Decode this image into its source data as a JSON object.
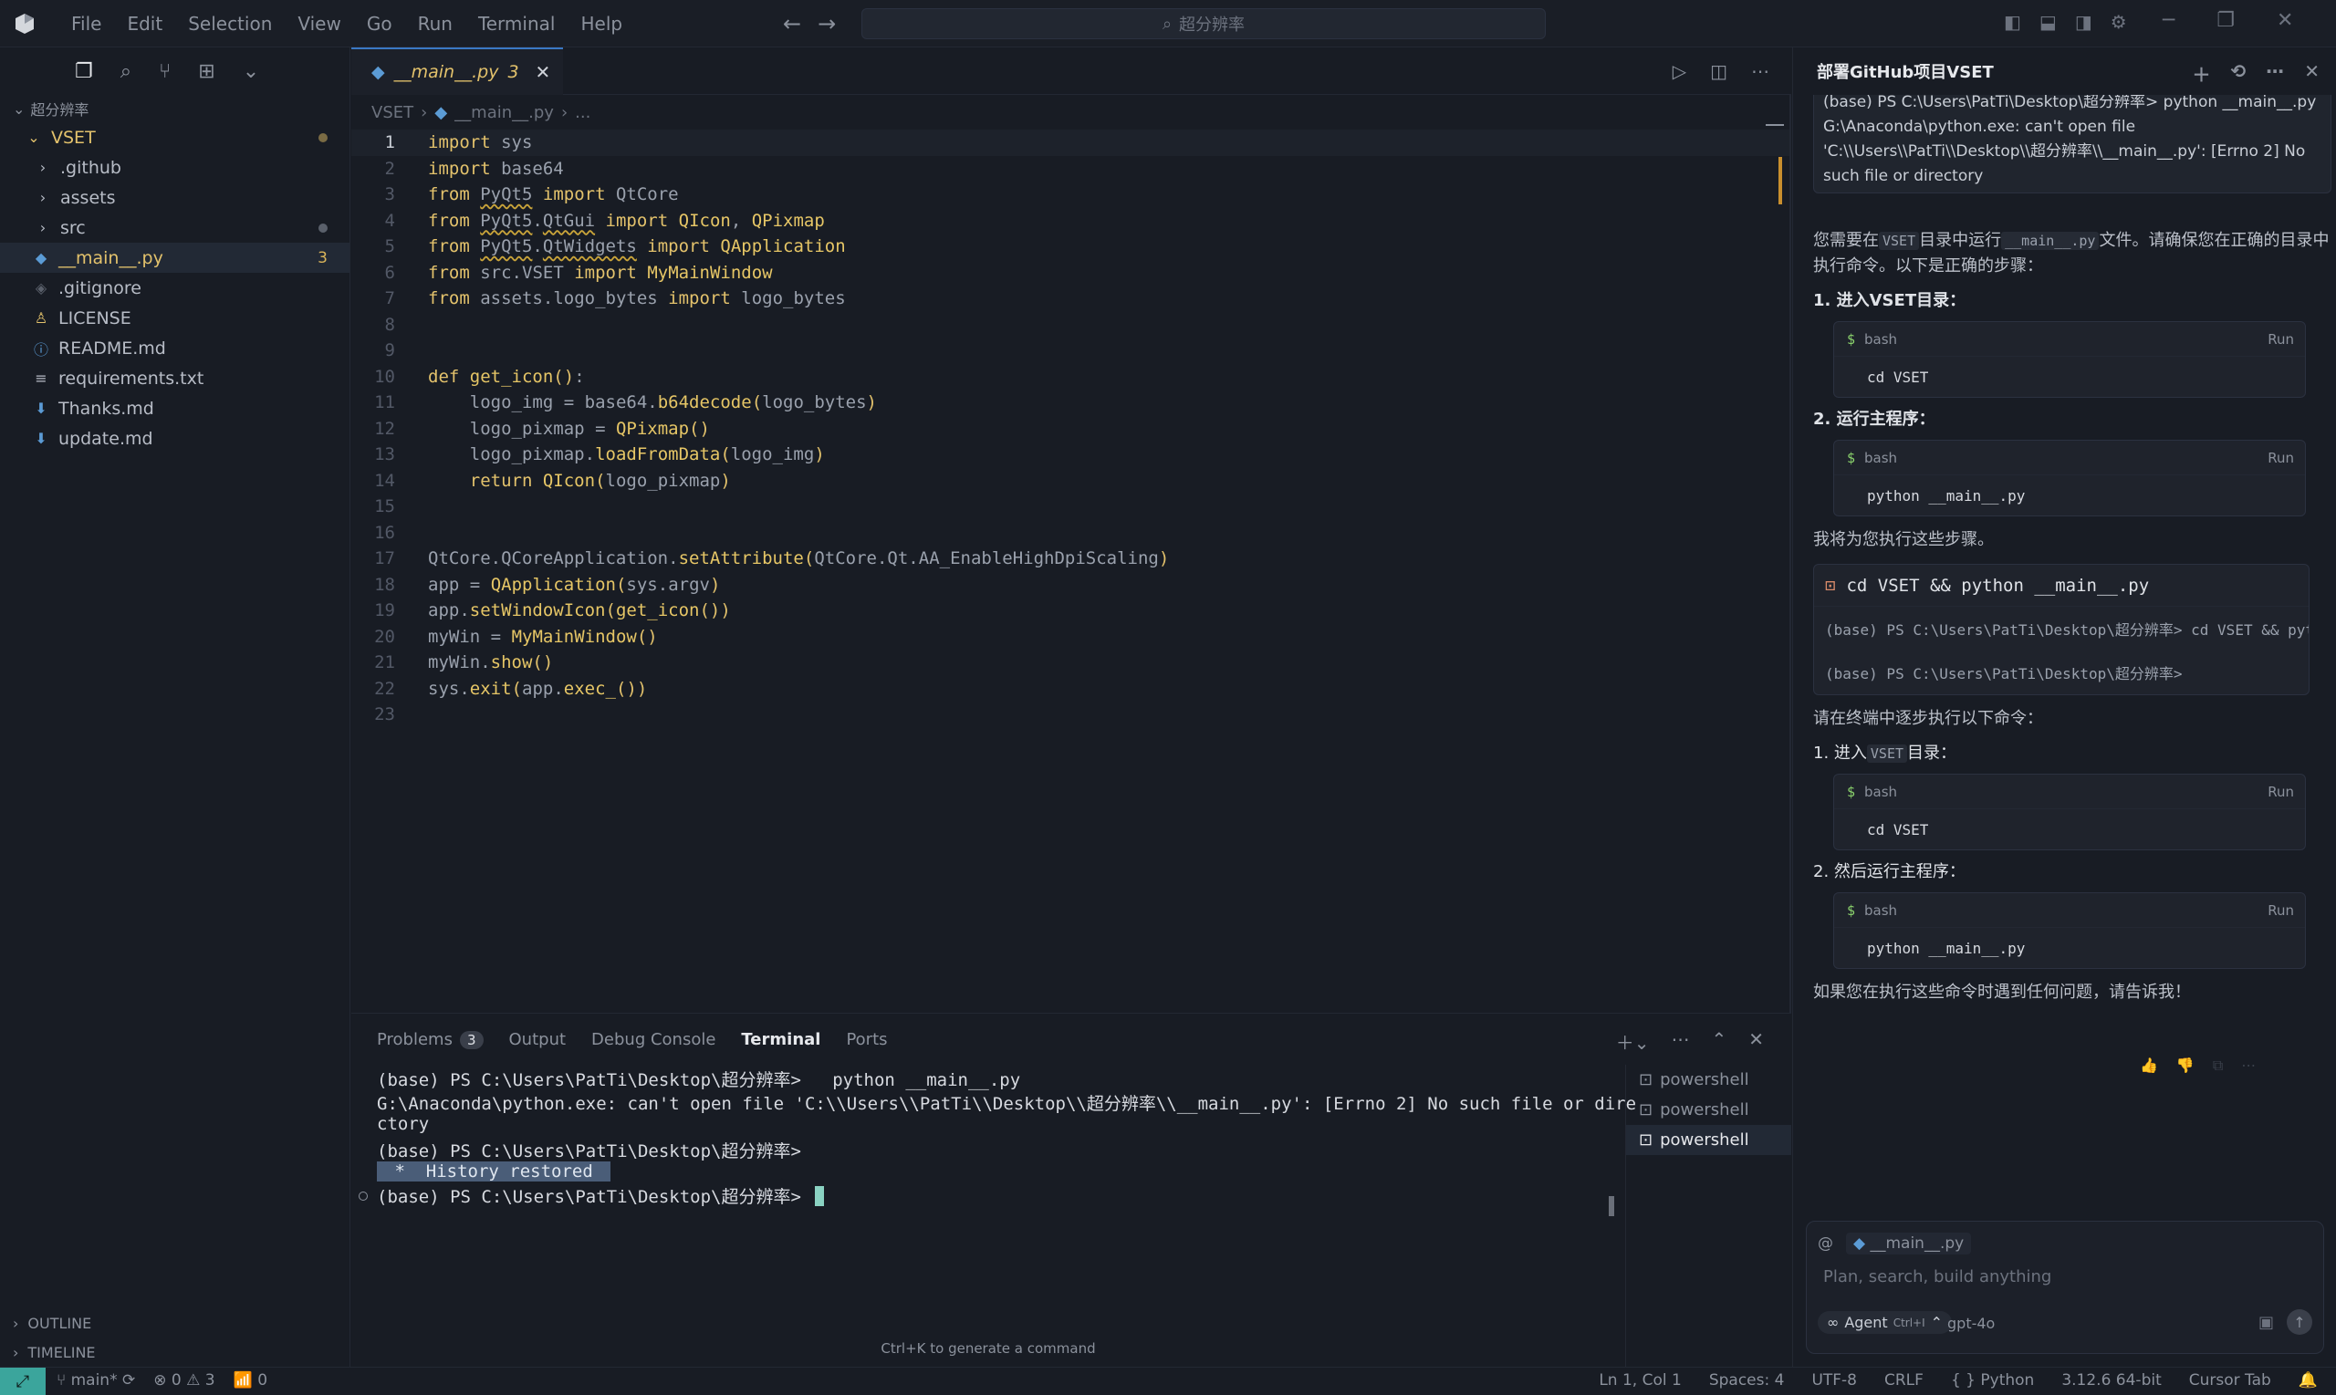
{
  "menu": [
    "File",
    "Edit",
    "Selection",
    "View",
    "Go",
    "Run",
    "Terminal",
    "Help"
  ],
  "search": {
    "placeholder": "超分辨率"
  },
  "explorer": {
    "workspace": "超分辨率",
    "root": "VSET",
    "items": [
      {
        "label": ".github",
        "type": "folder"
      },
      {
        "label": "assets",
        "type": "folder"
      },
      {
        "label": "src",
        "type": "folder"
      },
      {
        "label": "__main__.py",
        "type": "python",
        "badge": "3"
      },
      {
        "label": ".gitignore",
        "type": "git"
      },
      {
        "label": "LICENSE",
        "type": "license"
      },
      {
        "label": "README.md",
        "type": "info"
      },
      {
        "label": "requirements.txt",
        "type": "text"
      },
      {
        "label": "Thanks.md",
        "type": "md"
      },
      {
        "label": "update.md",
        "type": "md"
      }
    ],
    "outline": "OUTLINE",
    "timeline": "TIMELINE"
  },
  "editor": {
    "tab": {
      "label": "__main__.py",
      "problems": "3"
    },
    "breadcrumb": {
      "root": "VSET",
      "file": "__main__.py",
      "more": "..."
    },
    "code": [
      "import sys",
      "import base64",
      "from PyQt5 import QtCore",
      "from PyQt5.QtGui import QIcon, QPixmap",
      "from PyQt5.QtWidgets import QApplication",
      "from src.VSET import MyMainWindow",
      "from assets.logo_bytes import logo_bytes",
      "",
      "",
      "def get_icon():",
      "    logo_img = base64.b64decode(logo_bytes)",
      "    logo_pixmap = QPixmap()",
      "    logo_pixmap.loadFromData(logo_img)",
      "    return QIcon(logo_pixmap)",
      "",
      "",
      "QtCore.QCoreApplication.setAttribute(QtCore.Qt.AA_EnableHighDpiScaling)",
      "app = QApplication(sys.argv)",
      "app.setWindowIcon(get_icon())",
      "myWin = MyMainWindow()",
      "myWin.show()",
      "sys.exit(app.exec_())",
      ""
    ]
  },
  "panel": {
    "tabs": {
      "problems": "Problems",
      "problems_count": "3",
      "output": "Output",
      "debug": "Debug Console",
      "terminal": "Terminal",
      "ports": "Ports"
    },
    "terminal_lines": [
      "(base) PS C:\\Users\\PatTi\\Desktop\\超分辨率>   python __main__.py",
      "G:\\Anaconda\\python.exe: can't open file 'C:\\\\Users\\\\PatTi\\\\Desktop\\\\超分辨率\\\\__main__.py': [Errno 2] No such file or dire",
      "ctory",
      "(base) PS C:\\Users\\PatTi\\Desktop\\超分辨率>"
    ],
    "history": " *  History restored ",
    "prompt": "(base) PS C:\\Users\\PatTi\\Desktop\\超分辨率> ",
    "terminals": [
      "powershell",
      "powershell",
      "powershell"
    ],
    "hint": "Ctrl+K to generate a command"
  },
  "chat": {
    "title": "部署GitHub项目VSET",
    "error_text": "(base) PS C:\\Users\\PatTi\\Desktop\\超分辨率> python __main__.py G:\\Anaconda\\python.exe: can't open file 'C:\\\\Users\\\\PatTi\\\\Desktop\\\\超分辨率\\\\__main__.py': [Errno 2] No such file or directory",
    "intro_a": "您需要在",
    "intro_code1": "VSET",
    "intro_b": "目录中运行",
    "intro_code2": "__main__.py",
    "intro_c": "文件。请确保您在正确的目录中执行命令。以下是正确的步骤：",
    "step1": "1. 进入VSET目录：",
    "step2": "2. 运行主程序：",
    "lang": "bash",
    "run": "Run",
    "cmd_cd": "cd VSET",
    "cmd_python": "python __main__.py",
    "will_run": "我将为您执行这些步骤。",
    "term_cmd": "cd VSET && python __main__.py",
    "term_line1": "(base) PS C:\\Users\\PatTi\\Desktop\\超分辨率> cd VSET && python __main__.py",
    "term_line2": "(base) PS C:\\Users\\PatTi\\Desktop\\超分辨率>",
    "step_intro": "请在终端中逐步执行以下命令：",
    "step3a": "1. 进入",
    "step3code": "VSET",
    "step3b": "目录：",
    "step4": "2. 然后运行主程序：",
    "closing": "如果您在执行这些命令时遇到任何问题，请告诉我！",
    "context_file": "__main__.py",
    "input_placeholder": "Plan, search, build anything",
    "agent_label": "Agent",
    "agent_kbd": "Ctrl+I",
    "model": "gpt-4o"
  },
  "status": {
    "branch": "main*",
    "errors": "0",
    "warnings": "3",
    "ports": "0",
    "position": "Ln 1, Col 1",
    "spaces": "Spaces: 4",
    "encoding": "UTF-8",
    "eol": "CRLF",
    "language": "Python",
    "interpreter": "3.12.6 64-bit",
    "tab": "Cursor Tab"
  },
  "colors": {
    "accent": "#3a78c4",
    "keyword": "#e3c26c",
    "remote": "#3ba59c"
  }
}
